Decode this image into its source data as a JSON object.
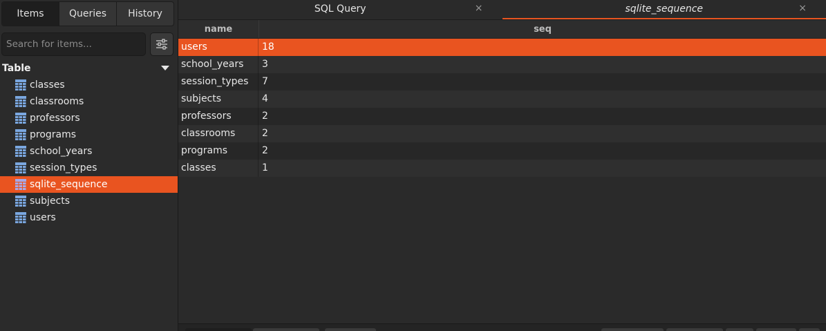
{
  "sidebar": {
    "tabs": [
      {
        "label": "Items",
        "active": true
      },
      {
        "label": "Queries",
        "active": false
      },
      {
        "label": "History",
        "active": false
      }
    ],
    "search": {
      "placeholder": "Search for items...",
      "value": ""
    },
    "filter_icon": "sliders-icon",
    "tree": {
      "header": "Table",
      "items": [
        {
          "label": "classes",
          "selected": false
        },
        {
          "label": "classrooms",
          "selected": false
        },
        {
          "label": "professors",
          "selected": false
        },
        {
          "label": "programs",
          "selected": false
        },
        {
          "label": "school_years",
          "selected": false
        },
        {
          "label": "session_types",
          "selected": false
        },
        {
          "label": "sqlite_sequence",
          "selected": true
        },
        {
          "label": "subjects",
          "selected": false
        },
        {
          "label": "users",
          "selected": false
        }
      ]
    }
  },
  "main": {
    "tabs": [
      {
        "label": "SQL Query",
        "active": false,
        "close": "×"
      },
      {
        "label": "sqlite_sequence",
        "active": true,
        "close": "×"
      }
    ],
    "grid": {
      "columns": [
        "name",
        "seq"
      ],
      "rows": [
        {
          "name": "users",
          "seq": "18",
          "selected": true
        },
        {
          "name": "school_years",
          "seq": "3",
          "selected": false
        },
        {
          "name": "session_types",
          "seq": "7",
          "selected": false
        },
        {
          "name": "subjects",
          "seq": "4",
          "selected": false
        },
        {
          "name": "professors",
          "seq": "2",
          "selected": false
        },
        {
          "name": "classrooms",
          "seq": "2",
          "selected": false
        },
        {
          "name": "programs",
          "seq": "2",
          "selected": false
        },
        {
          "name": "classes",
          "seq": "1",
          "selected": false
        }
      ]
    }
  },
  "colors": {
    "accent": "#e95420",
    "table_icon": "#7aa7e0",
    "table_icon_selected": "#a9a9e8"
  }
}
